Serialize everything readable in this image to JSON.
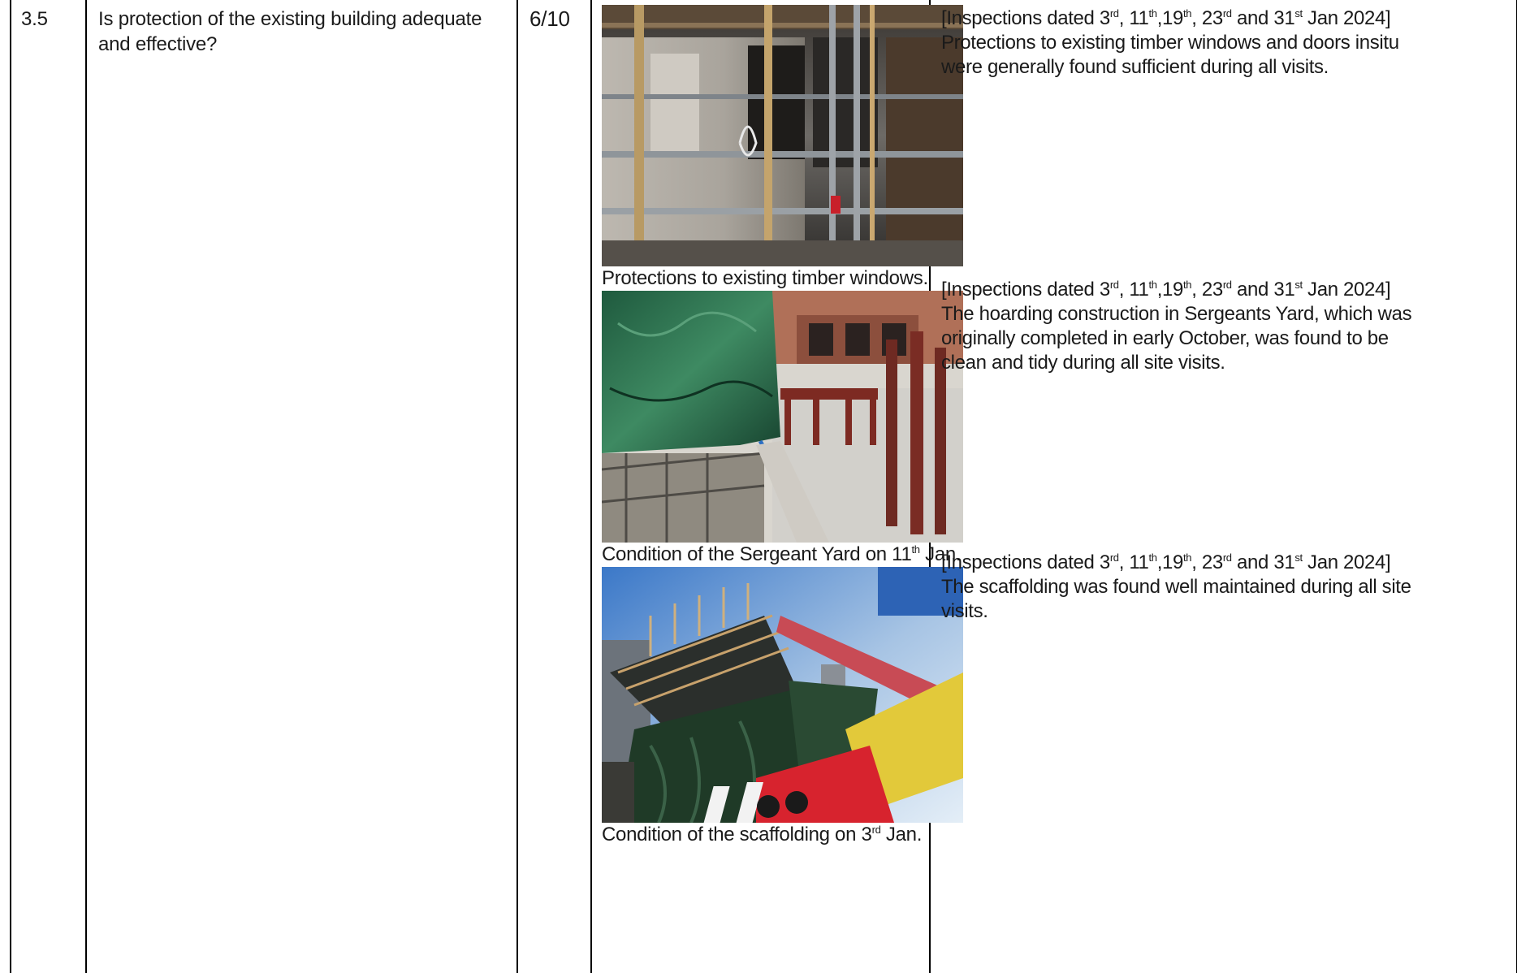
{
  "row": {
    "number": "3.5",
    "question": "Is protection of the existing building adequate and effective?",
    "score": "6/10"
  },
  "photos": [
    {
      "caption": "Protections to existing timber windows.",
      "image": "scaffolding-and-timber-window-protection-photo"
    },
    {
      "caption_main": "Condition of the Sergeant Yard on 11",
      "caption_sup": "th",
      "caption_end": " Jan.",
      "image": "sergeants-yard-hoarding-photo"
    },
    {
      "caption_main": "Condition of the scaffolding on 3",
      "caption_sup": "rd",
      "caption_end": " Jan.",
      "image": "scaffolding-crane-photo"
    }
  ],
  "inspection_header": {
    "prefix": "[Inspections dated 3",
    "sup1": "rd",
    "part2": ", 11",
    "sup2": "th",
    "part3": ",19",
    "sup3": "th",
    "part4": ", 23",
    "sup4": "rd",
    "part5": " and 31",
    "sup5": "st",
    "suffix": " Jan 2024]"
  },
  "remarks": [
    {
      "lines": [
        "Protections to existing timber windows and doors insitu",
        "were generally found sufficient during all visits."
      ]
    },
    {
      "lines": [
        "The hoarding construction in Sergeants Yard, which was",
        "originally completed in early October, was found to be",
        "clean and tidy during all site visits."
      ]
    },
    {
      "lines": [
        "The scaffolding was found well maintained during all site",
        "visits."
      ]
    }
  ]
}
